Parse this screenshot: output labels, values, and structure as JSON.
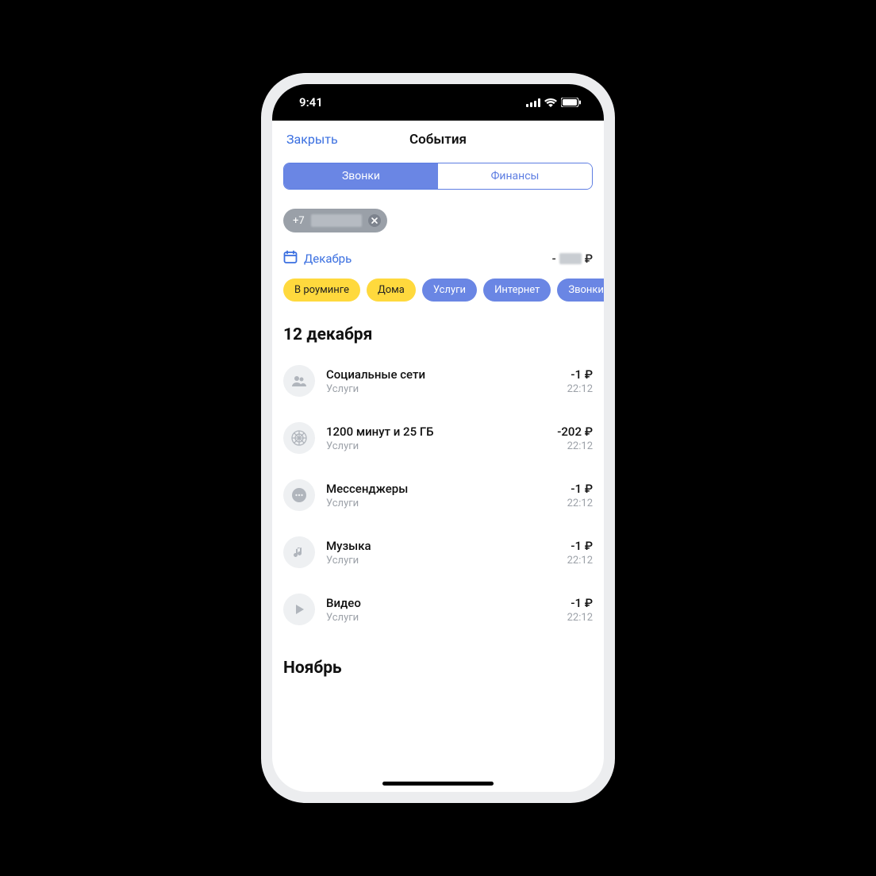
{
  "statusbar": {
    "time": "9:41"
  },
  "nav": {
    "close": "Закрыть",
    "title": "События"
  },
  "tabs": [
    {
      "label": "Звонки",
      "active": true
    },
    {
      "label": "Финансы",
      "active": false
    }
  ],
  "phone_chip": {
    "prefix": "+7"
  },
  "month_picker": {
    "label": "Декабрь"
  },
  "month_total": {
    "prefix": "-",
    "currency": "₽"
  },
  "filters": [
    {
      "label": "В роуминге",
      "kind": "yellow"
    },
    {
      "label": "Дома",
      "kind": "yellow"
    },
    {
      "label": "Услуги",
      "kind": "blue"
    },
    {
      "label": "Интернет",
      "kind": "blue"
    },
    {
      "label": "Звонки",
      "kind": "blue"
    }
  ],
  "section1": {
    "title": "12 декабря",
    "items": [
      {
        "icon": "people",
        "title": "Социальные сети",
        "sub": "Услуги",
        "amount": "-1 ₽",
        "time": "22:12"
      },
      {
        "icon": "plan",
        "title": "1200 минут и 25 ГБ",
        "sub": "Услуги",
        "amount": "-202 ₽",
        "time": "22:12"
      },
      {
        "icon": "chat",
        "title": "Мессенджеры",
        "sub": "Услуги",
        "amount": "-1 ₽",
        "time": "22:12"
      },
      {
        "icon": "music",
        "title": "Музыка",
        "sub": "Услуги",
        "amount": "-1 ₽",
        "time": "22:12"
      },
      {
        "icon": "play",
        "title": "Видео",
        "sub": "Услуги",
        "amount": "-1 ₽",
        "time": "22:12"
      }
    ]
  },
  "section2": {
    "title": "Ноябрь"
  }
}
